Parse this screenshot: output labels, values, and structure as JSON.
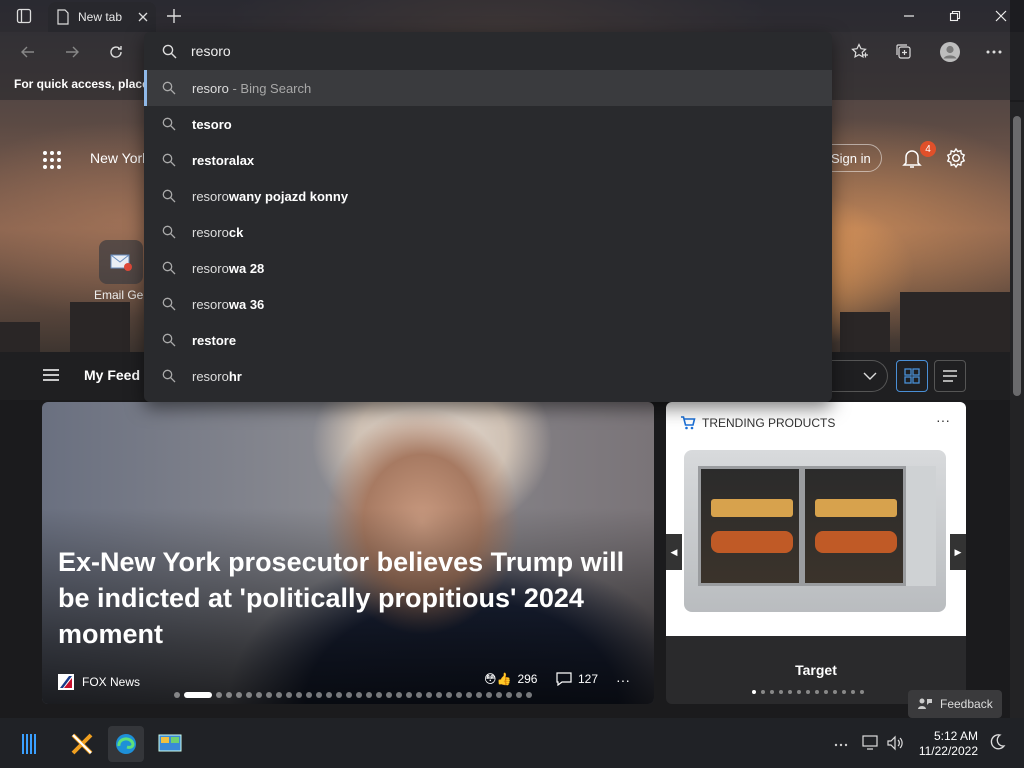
{
  "tabs": [
    {
      "title": "New tab"
    }
  ],
  "address": {
    "query": "resoro"
  },
  "suggestions": [
    {
      "prefix": "resoro",
      "bold": "",
      "suffix": " - Bing Search"
    },
    {
      "prefix": "",
      "bold": "tesoro",
      "suffix": ""
    },
    {
      "prefix": "",
      "bold": "restoralax",
      "suffix": ""
    },
    {
      "prefix": "resoro",
      "bold": "wany pojazd konny",
      "suffix": ""
    },
    {
      "prefix": "resoro",
      "bold": "ck",
      "suffix": ""
    },
    {
      "prefix": "resoro",
      "bold": "wa 28",
      "suffix": ""
    },
    {
      "prefix": "resoro",
      "bold": "wa 36",
      "suffix": ""
    },
    {
      "prefix": "",
      "bold": "restore",
      "suffix": ""
    },
    {
      "prefix": "resoro",
      "bold": "hr",
      "suffix": ""
    }
  ],
  "favorites_bar": {
    "hint": "For quick access, place y"
  },
  "ntp": {
    "location": "New York",
    "sign_in": "Sign in",
    "notification_count": "4",
    "quick_link": "Email Ger"
  },
  "feed": {
    "title": "My Feed",
    "hero": {
      "headline": "Ex-New York prosecutor believes Trump will be indicted at 'politically propitious' 2024 moment",
      "source": "FOX News",
      "reactions": "296",
      "comments": "127",
      "more": "···"
    },
    "trending": {
      "header": "TRENDING PRODUCTS",
      "more": "···",
      "store": "Target"
    },
    "feedback": "Feedback"
  },
  "taskbar": {
    "time": "5:12 AM",
    "date": "11/22/2022"
  },
  "colors": {
    "accent": "#4a8fd6",
    "badge": "#e0502a"
  }
}
